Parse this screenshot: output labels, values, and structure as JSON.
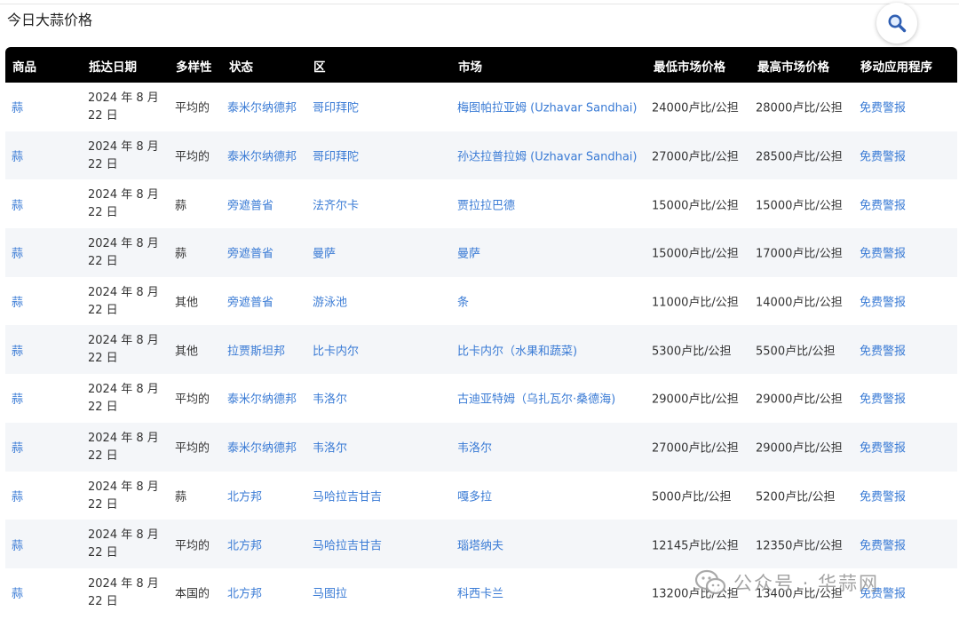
{
  "page": {
    "title": "今日大蒜价格"
  },
  "search": {
    "icon": "search-icon"
  },
  "table": {
    "headers": [
      "商品",
      "抵达日期",
      "多样性",
      "状态",
      "区",
      "市场",
      "最低市场价格",
      "最高市场价格",
      "移动应用程序"
    ],
    "rows": [
      {
        "commodity": "蒜",
        "date_line1": "2024 年 8 月",
        "date_line2": "22 日",
        "variety": "平均的",
        "state": "泰米尔纳德邦",
        "district": "哥印拜陀",
        "market": "梅图帕拉亚姆 (Uzhavar Sandhai)",
        "min": "24000卢比/公担",
        "max": "28000卢比/公担",
        "app": "免费警报"
      },
      {
        "commodity": "蒜",
        "date_line1": "2024 年 8 月",
        "date_line2": "22 日",
        "variety": "平均的",
        "state": "泰米尔纳德邦",
        "district": "哥印拜陀",
        "market": "孙达拉普拉姆 (Uzhavar Sandhai)",
        "min": "27000卢比/公担",
        "max": "28500卢比/公担",
        "app": "免费警报"
      },
      {
        "commodity": "蒜",
        "date_line1": "2024 年 8 月",
        "date_line2": "22 日",
        "variety": "蒜",
        "state": "旁遮普省",
        "district": "法齐尔卡",
        "market": "贾拉拉巴德",
        "min": "15000卢比/公担",
        "max": "15000卢比/公担",
        "app": "免费警报"
      },
      {
        "commodity": "蒜",
        "date_line1": "2024 年 8 月",
        "date_line2": "22 日",
        "variety": "蒜",
        "state": "旁遮普省",
        "district": "曼萨",
        "market": "曼萨",
        "min": "15000卢比/公担",
        "max": "17000卢比/公担",
        "app": "免费警报"
      },
      {
        "commodity": "蒜",
        "date_line1": "2024 年 8 月",
        "date_line2": "22 日",
        "variety": "其他",
        "state": "旁遮普省",
        "district": "游泳池",
        "market": "条",
        "min": "11000卢比/公担",
        "max": "14000卢比/公担",
        "app": "免费警报"
      },
      {
        "commodity": "蒜",
        "date_line1": "2024 年 8 月",
        "date_line2": "22 日",
        "variety": "其他",
        "state": "拉贾斯坦邦",
        "district": "比卡内尔",
        "market": "比卡内尔（水果和蔬菜)",
        "min": "5300卢比/公担",
        "max": "5500卢比/公担",
        "app": "免费警报"
      },
      {
        "commodity": "蒜",
        "date_line1": "2024 年 8 月",
        "date_line2": "22 日",
        "variety": "平均的",
        "state": "泰米尔纳德邦",
        "district": "韦洛尔",
        "market": "古迪亚特姆（乌扎瓦尔·桑德海)",
        "min": "29000卢比/公担",
        "max": "29000卢比/公担",
        "app": "免费警报"
      },
      {
        "commodity": "蒜",
        "date_line1": "2024 年 8 月",
        "date_line2": "22 日",
        "variety": "平均的",
        "state": "泰米尔纳德邦",
        "district": "韦洛尔",
        "market": "韦洛尔",
        "min": "27000卢比/公担",
        "max": "29000卢比/公担",
        "app": "免费警报"
      },
      {
        "commodity": "蒜",
        "date_line1": "2024 年 8 月",
        "date_line2": "22 日",
        "variety": "蒜",
        "state": "北方邦",
        "district": "马哈拉吉甘吉",
        "market": "嘎多拉",
        "min": "5000卢比/公担",
        "max": "5200卢比/公担",
        "app": "免费警报"
      },
      {
        "commodity": "蒜",
        "date_line1": "2024 年 8 月",
        "date_line2": "22 日",
        "variety": "平均的",
        "state": "北方邦",
        "district": "马哈拉吉甘吉",
        "market": "瑙塔纳夫",
        "min": "12145卢比/公担",
        "max": "12350卢比/公担",
        "app": "免费警报"
      },
      {
        "commodity": "蒜",
        "date_line1": "2024 年 8 月",
        "date_line2": "22 日",
        "variety": "本国的",
        "state": "北方邦",
        "district": "马图拉",
        "market": "科西卡兰",
        "min": "13200卢比/公担",
        "max": "13400卢比/公担",
        "app": "免费警报"
      }
    ]
  },
  "watermark": {
    "text": "公众号 · 华蒜网",
    "icon": "wechat-icon"
  },
  "colors": {
    "header_bg": "#000000",
    "link": "#3a7bd5",
    "alt_row": "#f4f6f9"
  }
}
